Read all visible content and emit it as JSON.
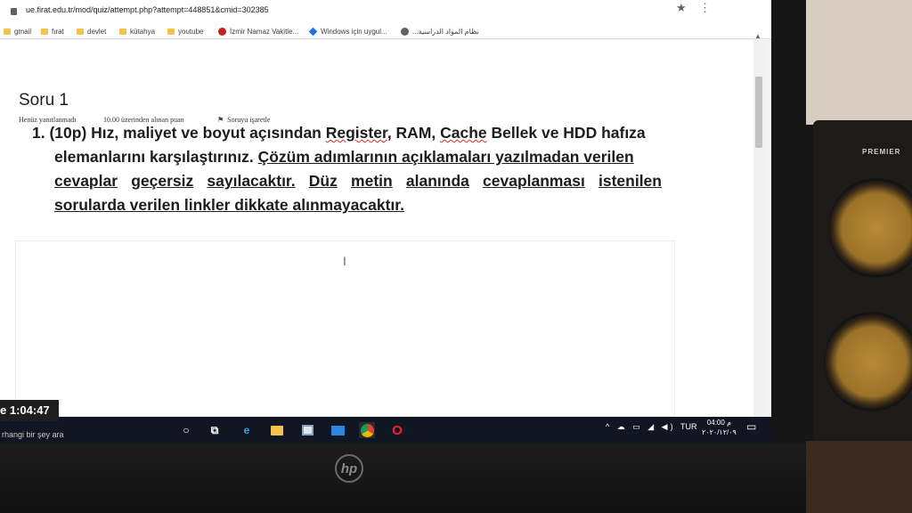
{
  "browser": {
    "url": "ue.firat.edu.tr/mod/quiz/attempt.php?attempt=448851&cmid=302385",
    "bookmarks": [
      {
        "label": "gmail",
        "icon": "folder-icon"
      },
      {
        "label": "fırat",
        "icon": "folder-icon"
      },
      {
        "label": "devlet",
        "icon": "folder-icon"
      },
      {
        "label": "kütahya",
        "icon": "folder-icon"
      },
      {
        "label": "youtube",
        "icon": "folder-icon"
      },
      {
        "label": "İzmir Namaz Vakitle...",
        "icon": "red-circle-icon"
      },
      {
        "label": "Windows için uygul...",
        "icon": "windows-icon"
      },
      {
        "label": "...نظام المواد الدراسية",
        "icon": "globe-icon"
      }
    ]
  },
  "quiz": {
    "title": "Soru 1",
    "status": "Henüz yanıtlanmadı",
    "points": "10.00 üzerinden alınan puan",
    "flag_label": "Soruyu işaretle",
    "q_number": "1.",
    "q_points": "(10p)",
    "line1_a": "Hız, maliyet ve boyut açısından",
    "line1_register": "Register",
    "line1_b": ", RAM,",
    "line1_cache": "Cache",
    "line1_c": "Bellek ve HDD hafıza",
    "line2_a": "elemanlarını karşılaştırınız.",
    "line2_b": "Çözüm adımlarının açıklamaları yazılmadan verilen",
    "line3_words": [
      "cevaplar",
      "geçersiz",
      "sayılacaktır.",
      "Düz",
      "metin",
      "alanında",
      "cevaplanması",
      "istenilen"
    ],
    "line4": "sorularda verilen linkler dikkate alınmayacaktır."
  },
  "taskbar": {
    "timer": "e 1:04:47",
    "search_placeholder": "rhangi bir şey ara",
    "language": "TUR",
    "time": "04:00 م",
    "date": "٢٠٢٠/١٢/٠٩"
  },
  "device": {
    "brand_logo": "hp",
    "speaker_label": "PREMIER"
  }
}
